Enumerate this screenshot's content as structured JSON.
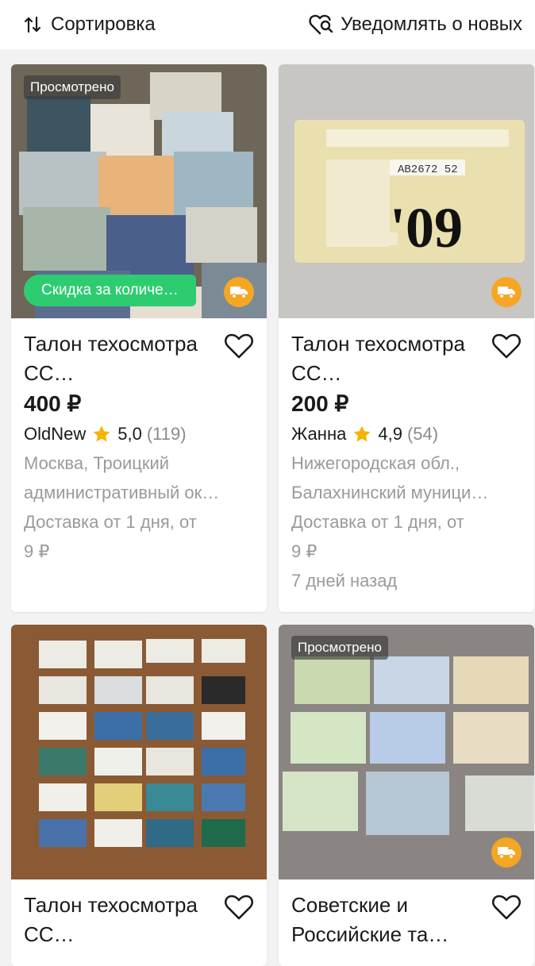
{
  "toolbar": {
    "sort_label": "Сортировка",
    "notify_label": "Уведомлять о новых"
  },
  "colors": {
    "accent_green": "#2ecc71",
    "delivery_orange": "#f5a623",
    "star": "#f5b400"
  },
  "listings": [
    {
      "badge": "Просмотрено",
      "discount": "Скидка за количе…",
      "has_delivery": true,
      "title": "Талон техосмотра СС…",
      "price": "400 ₽",
      "seller": "OldNew",
      "rating": "5,0",
      "reviews": "(119)",
      "location_line1": "Москва, Троицкий",
      "location_line2": "административный ок…",
      "delivery_line1": "Доставка от 1 дня, от",
      "delivery_line2": "9 ₽"
    },
    {
      "has_delivery": true,
      "title": "Талон техосмотра СС…",
      "price": "200 ₽",
      "seller": "Жанна",
      "rating": "4,9",
      "reviews": "(54)",
      "location_line1": "Нижегородская обл.,",
      "location_line2": "Балахнинский муници…",
      "delivery_line1": "Доставка от 1 дня, от",
      "delivery_line2": "9 ₽",
      "date": "7 дней назад"
    },
    {
      "title": "Талон техосмотра СС…"
    },
    {
      "badge": "Просмотрено",
      "has_delivery": true,
      "title": "Советские и Российские та…"
    }
  ]
}
